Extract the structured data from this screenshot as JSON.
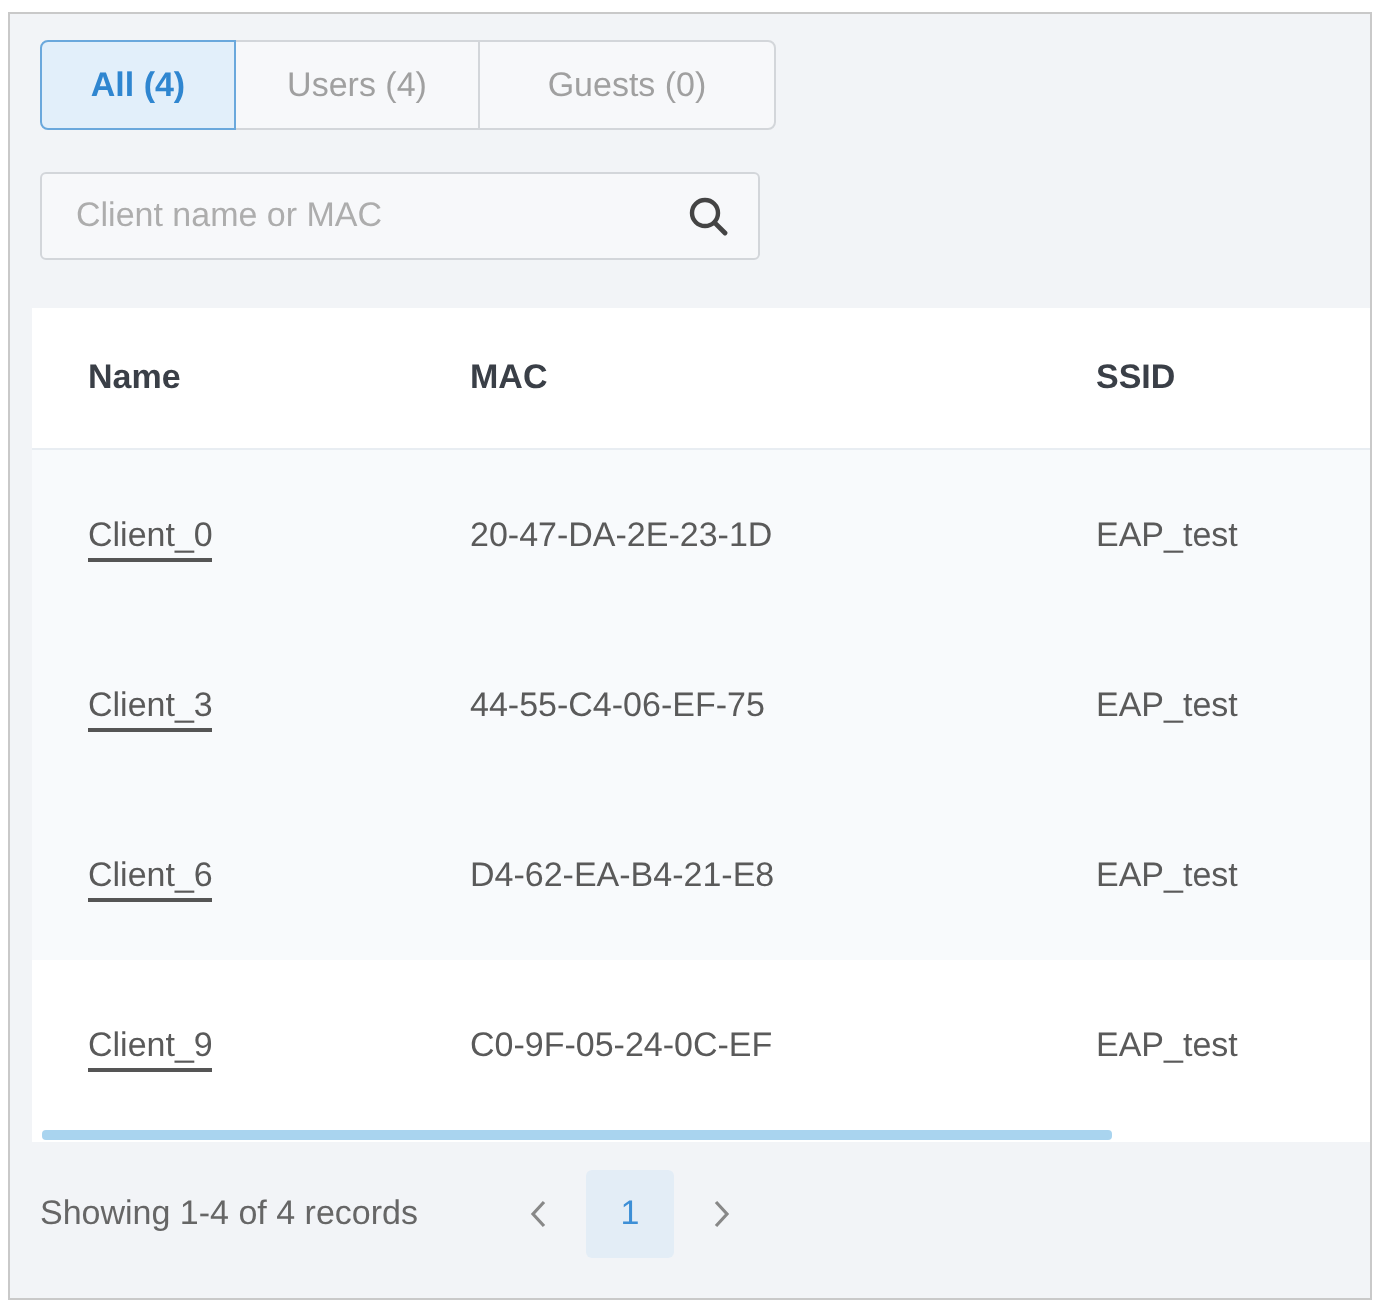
{
  "tabs": [
    {
      "label": "All (4)",
      "selected": true
    },
    {
      "label": "Users (4)",
      "selected": false
    },
    {
      "label": "Guests (0)",
      "selected": false
    }
  ],
  "search": {
    "placeholder": "Client name or MAC"
  },
  "table": {
    "columns": [
      "Name",
      "MAC",
      "SSID"
    ],
    "rows": [
      {
        "name": "Client_0",
        "mac": "20-47-DA-2E-23-1D",
        "ssid": "EAP_test"
      },
      {
        "name": "Client_3",
        "mac": "44-55-C4-06-EF-75",
        "ssid": "EAP_test"
      },
      {
        "name": "Client_6",
        "mac": "D4-62-EA-B4-21-E8",
        "ssid": "EAP_test"
      },
      {
        "name": "Client_9",
        "mac": "C0-9F-05-24-0C-EF",
        "ssid": "EAP_test"
      }
    ]
  },
  "pagination": {
    "summary": "Showing 1-4 of 4 records",
    "pages": [
      {
        "label": "1",
        "selected": true
      }
    ]
  }
}
